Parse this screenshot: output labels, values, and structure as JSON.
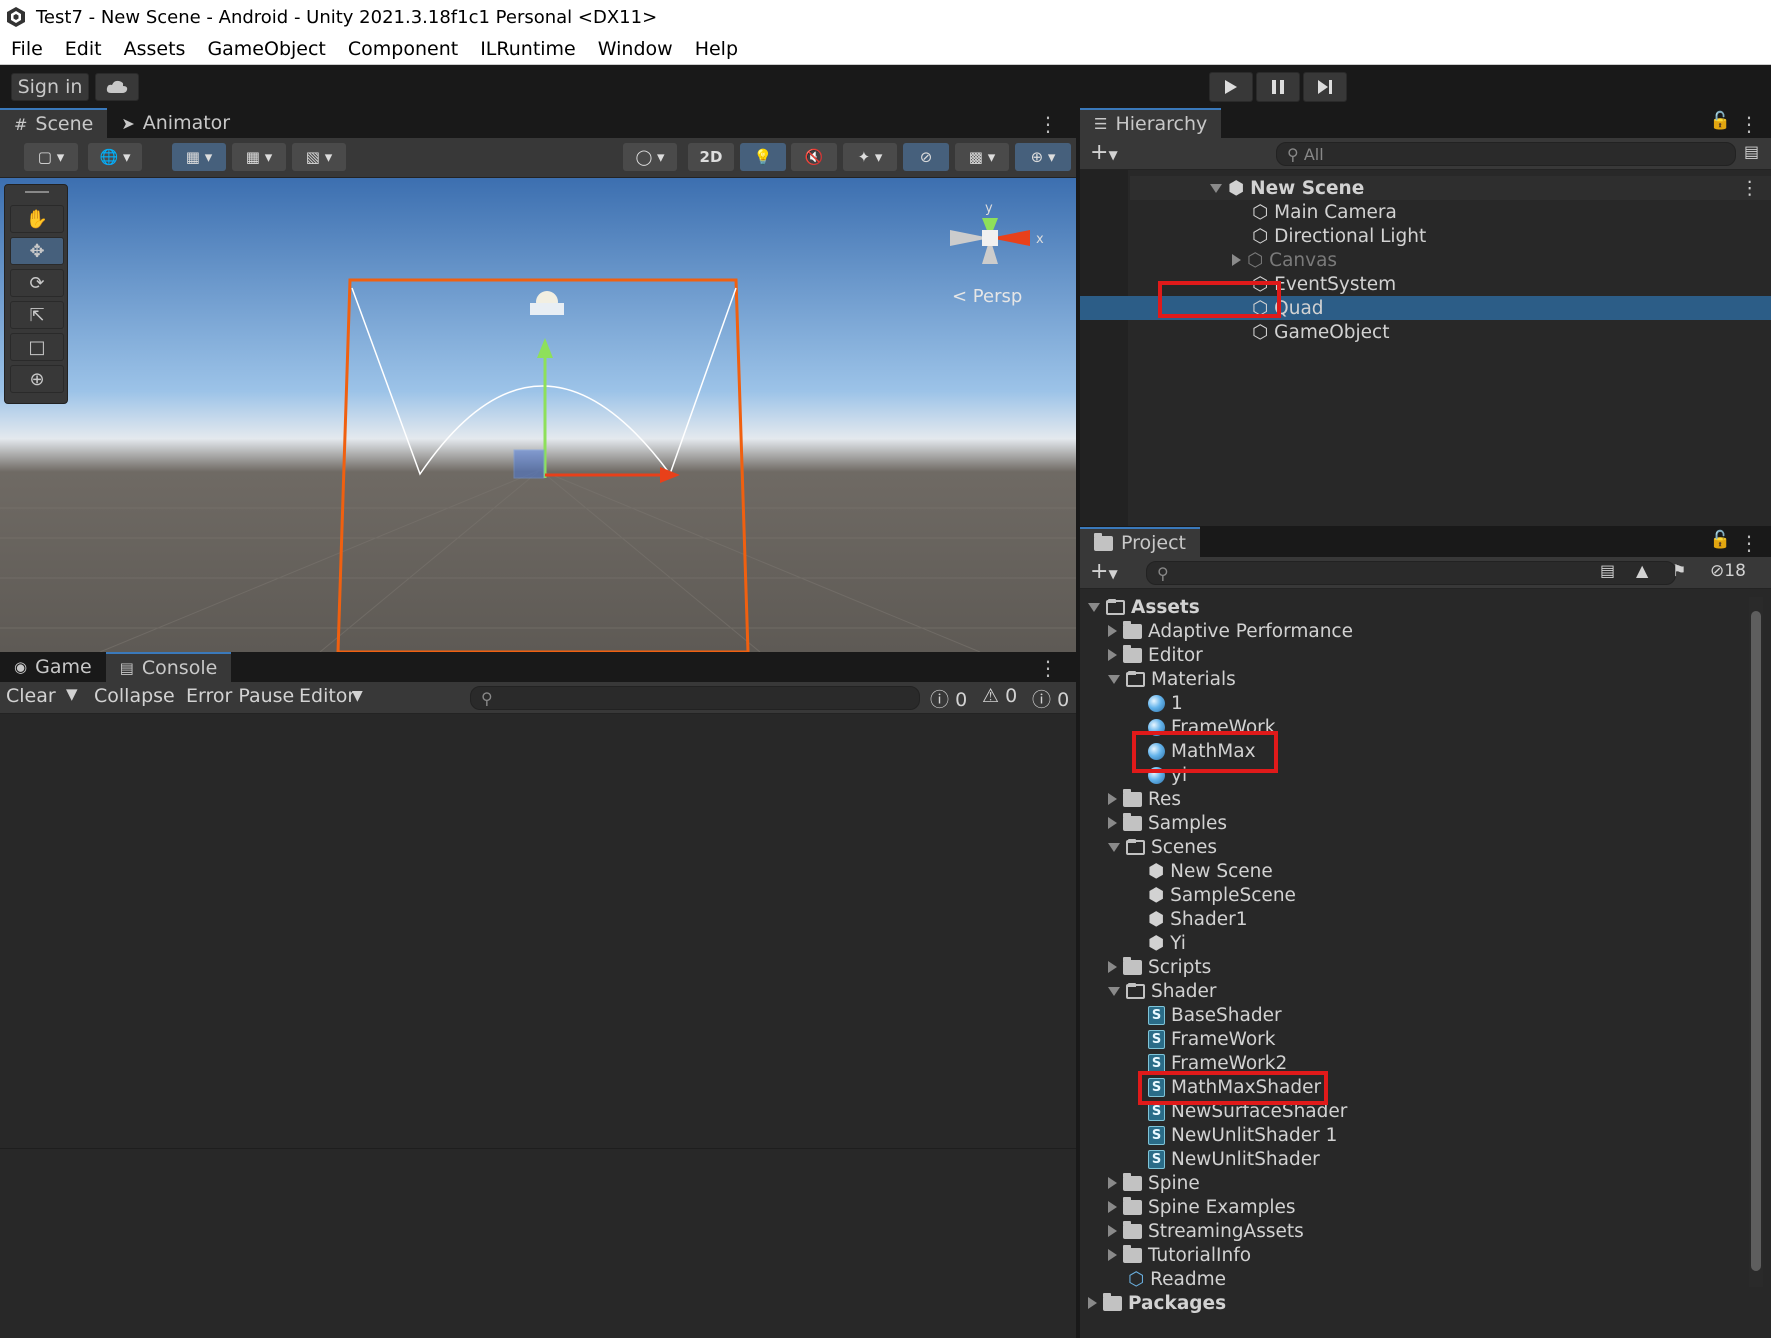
{
  "window": {
    "title": "Test7 - New Scene - Android - Unity 2021.3.18f1c1 Personal <DX11>"
  },
  "menu": [
    "File",
    "Edit",
    "Assets",
    "GameObject",
    "Component",
    "ILRuntime",
    "Window",
    "Help"
  ],
  "toolbar": {
    "sign_in": "Sign in"
  },
  "scene_tabs": {
    "scene": "Scene",
    "animator": "Animator"
  },
  "scene_toolbar": {
    "mode_2d": "2D"
  },
  "scene_view": {
    "persp_label": "< Persp",
    "gizmo_y": "y",
    "gizmo_x": "x",
    "sky_top": "#3c6fb0",
    "ground": "#5e5a55"
  },
  "hierarchy": {
    "tab": "Hierarchy",
    "search_placeholder": "All",
    "scene": "New Scene",
    "items": [
      {
        "label": "Main Camera"
      },
      {
        "label": "Directional Light"
      },
      {
        "label": "Canvas"
      },
      {
        "label": "EventSystem"
      },
      {
        "label": "Quad"
      },
      {
        "label": "GameObject"
      }
    ]
  },
  "project": {
    "tab": "Project",
    "hidden_count": "18",
    "root": "Assets",
    "items": [
      {
        "label": "Adaptive Performance"
      },
      {
        "label": "Editor"
      },
      {
        "label": "Materials"
      },
      {
        "label": "1"
      },
      {
        "label": "FrameWork"
      },
      {
        "label": "MathMax"
      },
      {
        "label": "yi"
      },
      {
        "label": "Res"
      },
      {
        "label": "Samples"
      },
      {
        "label": "Scenes"
      },
      {
        "label": "New Scene"
      },
      {
        "label": "SampleScene"
      },
      {
        "label": "Shader1"
      },
      {
        "label": "Yi"
      },
      {
        "label": "Scripts"
      },
      {
        "label": "Shader"
      },
      {
        "label": "BaseShader"
      },
      {
        "label": "FrameWork"
      },
      {
        "label": "FrameWork2"
      },
      {
        "label": "MathMaxShader"
      },
      {
        "label": "NewSurfaceShader"
      },
      {
        "label": "NewUnlitShader 1"
      },
      {
        "label": "NewUnlitShader"
      },
      {
        "label": "Spine"
      },
      {
        "label": "Spine Examples"
      },
      {
        "label": "StreamingAssets"
      },
      {
        "label": "TutorialInfo"
      },
      {
        "label": "Readme"
      }
    ],
    "packages": "Packages"
  },
  "console": {
    "tab_game": "Game",
    "tab_console": "Console",
    "clear": "Clear",
    "collapse": "Collapse",
    "error_pause": "Error Pause",
    "editor": "Editor",
    "count_log": "0",
    "count_warn": "0",
    "count_error": "0"
  },
  "colors": {
    "highlight": "#e01a1a",
    "selection": "#2c5d87",
    "accent": "#3a79bb"
  }
}
